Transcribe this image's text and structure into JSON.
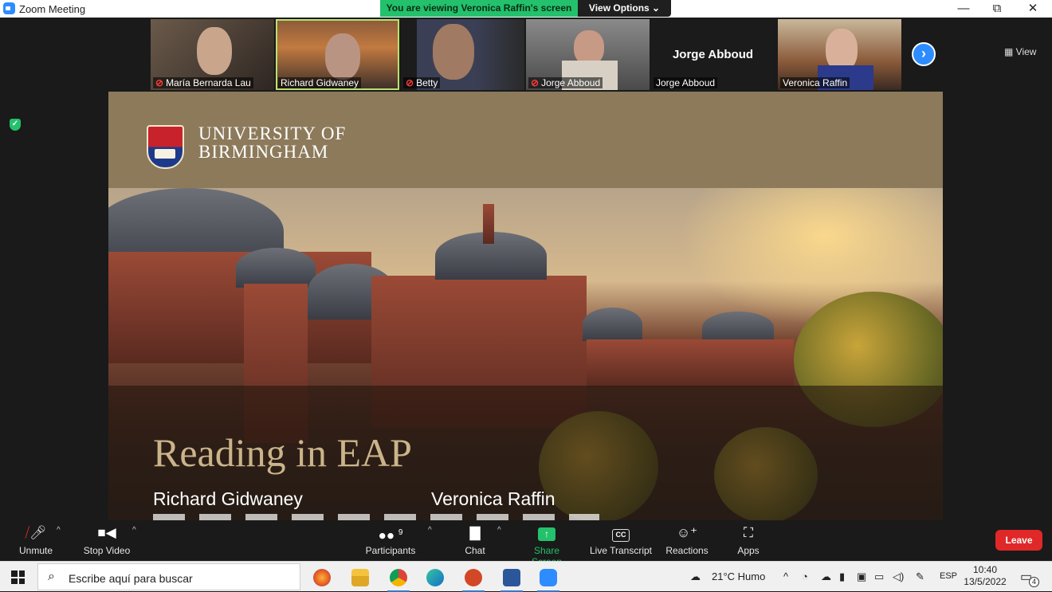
{
  "window": {
    "title": "Zoom Meeting",
    "banner": "You are viewing Veronica Raffin's screen",
    "view_options": "View Options ⌄",
    "minimize": "—",
    "restore": "⧉",
    "close": "✕"
  },
  "gallery": {
    "view_label": "View",
    "participants": [
      {
        "name": "María Bernarda Lau",
        "muted": true
      },
      {
        "name": "Richard Gidwaney",
        "muted": false,
        "speaking": true
      },
      {
        "name": "Betty",
        "muted": true
      },
      {
        "name": "Jorge Abboud",
        "muted": true
      },
      {
        "name": "Jorge Abboud",
        "muted": false,
        "video_off": true,
        "display_name": "Jorge Abboud"
      },
      {
        "name": "Veronica Raffin",
        "muted": false
      }
    ],
    "next_arrow": "›"
  },
  "slide": {
    "university_line1": "UNIVERSITY OF",
    "university_line2": "BIRMINGHAM",
    "title": "Reading in EAP",
    "presenter_1": "Richard Gidwaney",
    "presenter_2": "Veronica Raffin"
  },
  "toolbar": {
    "unmute": "Unmute",
    "stop_video": "Stop Video",
    "participants": "Participants",
    "participants_count": "9",
    "chat": "Chat",
    "share_screen": "Share Screen",
    "live_transcript": "Live Transcript",
    "cc_label": "CC",
    "reactions": "Reactions",
    "apps": "Apps",
    "leave": "Leave"
  },
  "taskbar": {
    "search_placeholder": "Escribe aquí para buscar",
    "weather": "21°C  Humo",
    "language": "ESP",
    "time": "10:40",
    "date": "13/5/2022",
    "notifications": "4",
    "apps": [
      "firefox-icon",
      "file-explorer-icon",
      "chrome-icon",
      "edge-icon",
      "powerpoint-icon",
      "word-icon",
      "zoom-icon"
    ]
  },
  "colors": {
    "zoom_blue": "#2d8cff",
    "banner_green": "#23c16b",
    "leave_red": "#e02828",
    "slide_header": "#8c7a5b",
    "title_gold": "#cbb48a"
  }
}
